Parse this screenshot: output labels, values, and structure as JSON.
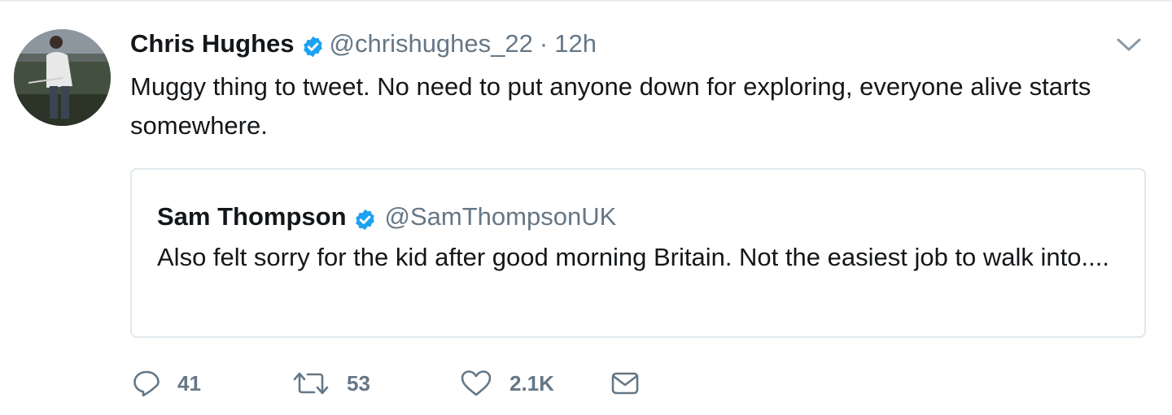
{
  "tweet": {
    "author_name": "Chris Hughes",
    "handle": "@chrishughes_22",
    "separator": "·",
    "time": "12h",
    "text": "Muggy thing to tweet. No need to put anyone down for exploring, everyone alive starts somewhere.",
    "avatar_icon": "profile-photo",
    "verified_icon": "verified-badge-icon",
    "menu_icon": "chevron-down-icon"
  },
  "quoted_tweet": {
    "author_name": "Sam Thompson",
    "handle": "@SamThompsonUK",
    "text": "Also felt sorry for the kid after good morning Britain. Not the easiest job to walk into....",
    "verified_icon": "verified-badge-icon"
  },
  "actions": {
    "reply": {
      "icon": "reply-icon",
      "count": "41"
    },
    "retweet": {
      "icon": "retweet-icon",
      "count": "53"
    },
    "like": {
      "icon": "heart-icon",
      "count": "2.1K"
    },
    "message": {
      "icon": "envelope-icon"
    }
  },
  "colors": {
    "text": "#14171a",
    "secondary": "#657786",
    "verified": "#1da1f2",
    "border": "#e1e8ed"
  }
}
